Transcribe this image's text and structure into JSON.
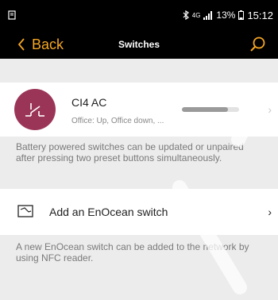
{
  "status_bar": {
    "network": "4G",
    "battery": "13%",
    "time": "15:12",
    "icons": [
      "notification-icon",
      "bluetooth-icon",
      "signal-icon",
      "battery-icon"
    ]
  },
  "app_bar": {
    "back_label": "Back",
    "title": "Switches",
    "search_icon": "search-icon"
  },
  "device": {
    "name": "CI4 AC",
    "subtitle": "Office: Up, Office down, ...",
    "progress": 0.8,
    "icon": "switch-icon"
  },
  "battery_info": "Battery powered switches can be updated or unpaired after pressing two preset buttons simultaneously.",
  "add_switch": {
    "label": "Add an EnOcean switch",
    "icon": "enocean-switch-icon"
  },
  "nfc_info": "A new EnOcean switch can be added to the network by using NFC reader.",
  "colors": {
    "accent": "#f5a623",
    "avatar": "#9b3557",
    "background": "#ececec"
  }
}
